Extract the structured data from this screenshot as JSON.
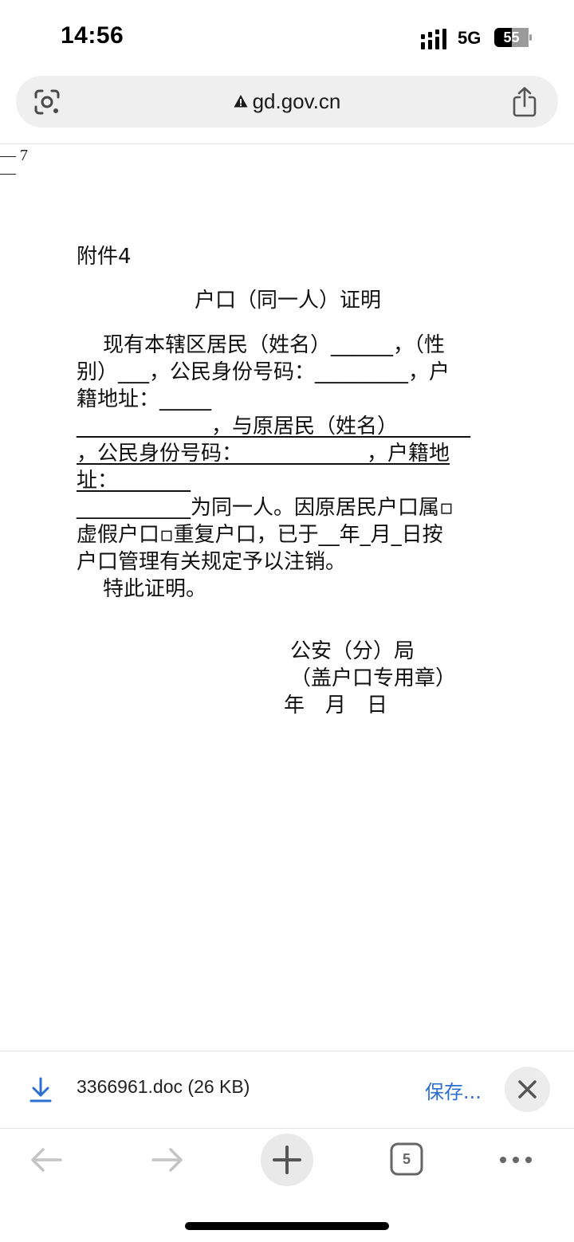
{
  "status_bar": {
    "time": "14:56",
    "network": "5G",
    "battery": "55"
  },
  "browser": {
    "url": "gd.gov.cn",
    "tab_count": "5"
  },
  "document": {
    "page_number": "— 7",
    "page_number_dash": "—",
    "attachment_label": "附件4",
    "title": "户口（同一人）证明",
    "lines": [
      "    现有本辖区居民（姓名）______，（性",
      "别）___，公民身份号码：_________，户",
      "籍地址：_____",
      "_____________，与原居民（姓名）_______",
      "，公民身份号码：____________，户籍地",
      "址：_______",
      "___________为同一人。因原居民户口属▫",
      "虚假户口▫重复户口，已于__年_月_日按",
      "户口管理有关规定予以注销。",
      "    特此证明。"
    ],
    "signature": {
      "office": "公安（分）局",
      "seal": "（盖户口专用章）",
      "date": "年　月　日"
    }
  },
  "download": {
    "filename": "3366961.doc (26 KB)",
    "save_label": "保存..."
  },
  "icons": {
    "lens": "google-lens-icon",
    "lock": "warning-lock-icon",
    "share": "share-icon",
    "download": "download-icon",
    "close": "close-icon",
    "back": "back-arrow-icon",
    "forward": "forward-arrow-icon",
    "new_tab": "plus-icon",
    "tabs": "tab-switcher-icon",
    "more": "more-dots-icon"
  },
  "colors": {
    "accent": "#2a6fd0",
    "url_bar_bg": "#efefef"
  }
}
